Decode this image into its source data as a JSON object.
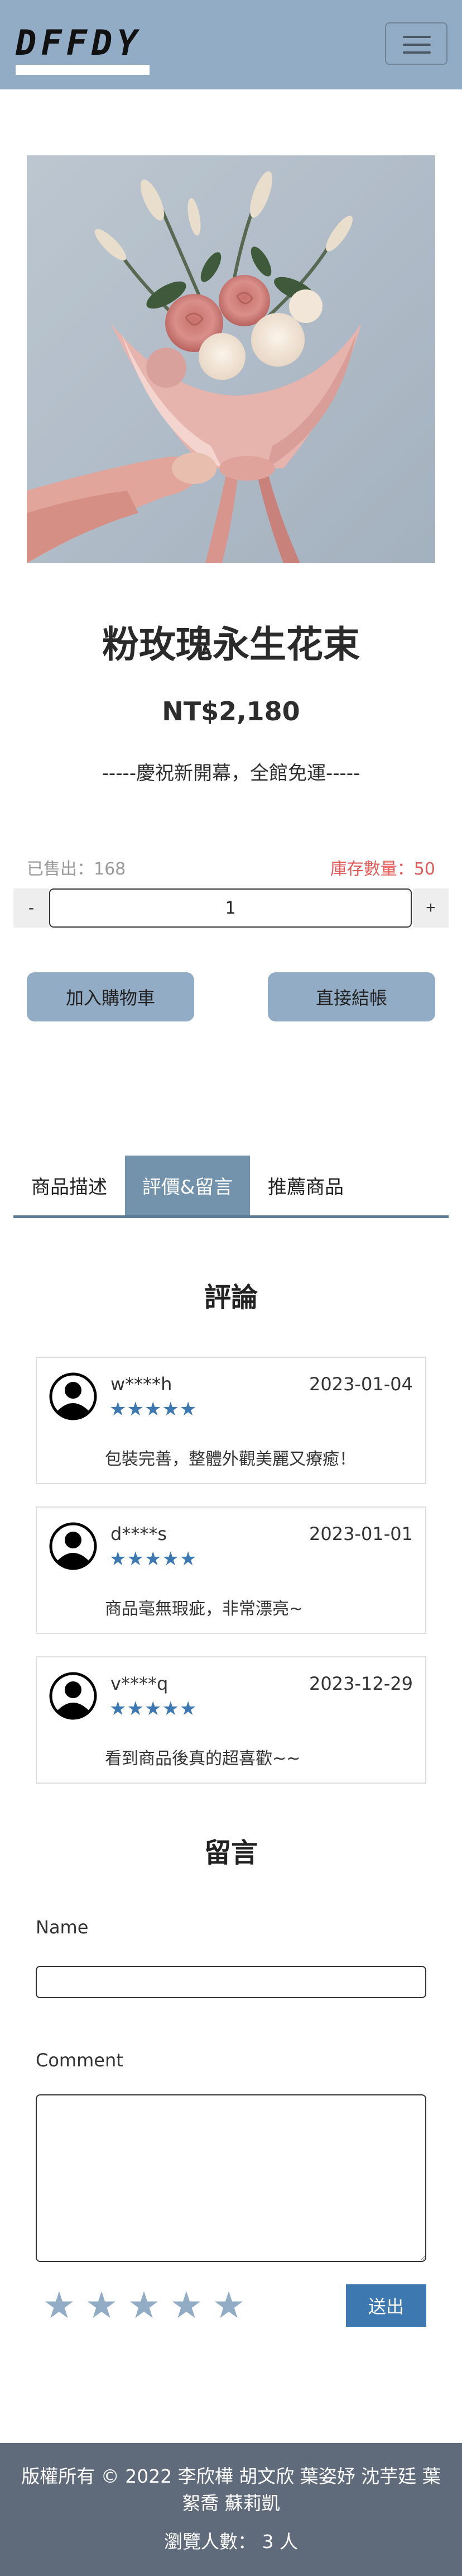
{
  "header": {
    "logo_text": "DFFDY",
    "menu_icon": "hamburger-icon"
  },
  "product": {
    "title": "粉玫瑰永生花束",
    "price": "NT$2,180",
    "promo": "-----慶祝新開幕，全館免運-----",
    "sold_label": "已售出：168",
    "stock_label": "庫存數量：50",
    "quantity_value": "1",
    "minus_label": "-",
    "plus_label": "+",
    "add_to_cart_label": "加入購物車",
    "checkout_label": "直接結帳"
  },
  "tabs": [
    {
      "label": "商品描述",
      "active": false
    },
    {
      "label": "評價&留言",
      "active": true
    },
    {
      "label": "推薦商品",
      "active": false
    }
  ],
  "reviews": {
    "heading": "評論",
    "items": [
      {
        "user": "w****h",
        "date": "2023-01-04",
        "stars": "★★★★★",
        "text": "包裝完善，整體外觀美麗又療癒！"
      },
      {
        "user": "d****s",
        "date": "2023-01-01",
        "stars": "★★★★★",
        "text": "商品毫無瑕疵，非常漂亮~"
      },
      {
        "user": "v****q",
        "date": "2023-12-29",
        "stars": "★★★★★",
        "text": "看到商品後真的超喜歡~~"
      }
    ]
  },
  "comment_form": {
    "heading": "留言",
    "name_label": "Name",
    "comment_label": "Comment",
    "rating_stars": [
      "★",
      "★",
      "★",
      "★",
      "★"
    ],
    "rating_value": 0,
    "submit_label": "送出"
  },
  "footer": {
    "copyright": "版權所有 © 2022 李欣樺 胡文欣 葉姿妤 沈芋廷 葉絮喬 蘇莉凱",
    "visitors": "瀏覽人數： 3 人"
  },
  "colors": {
    "navbar": "#93acc6",
    "active_tab": "#7392ac",
    "tab_underline": "#5a7a96",
    "review_stars": "#3d79b0",
    "stock_text": "#e05a5a",
    "submit_button": "#3d79b0",
    "footer": "#5f6b7b"
  }
}
